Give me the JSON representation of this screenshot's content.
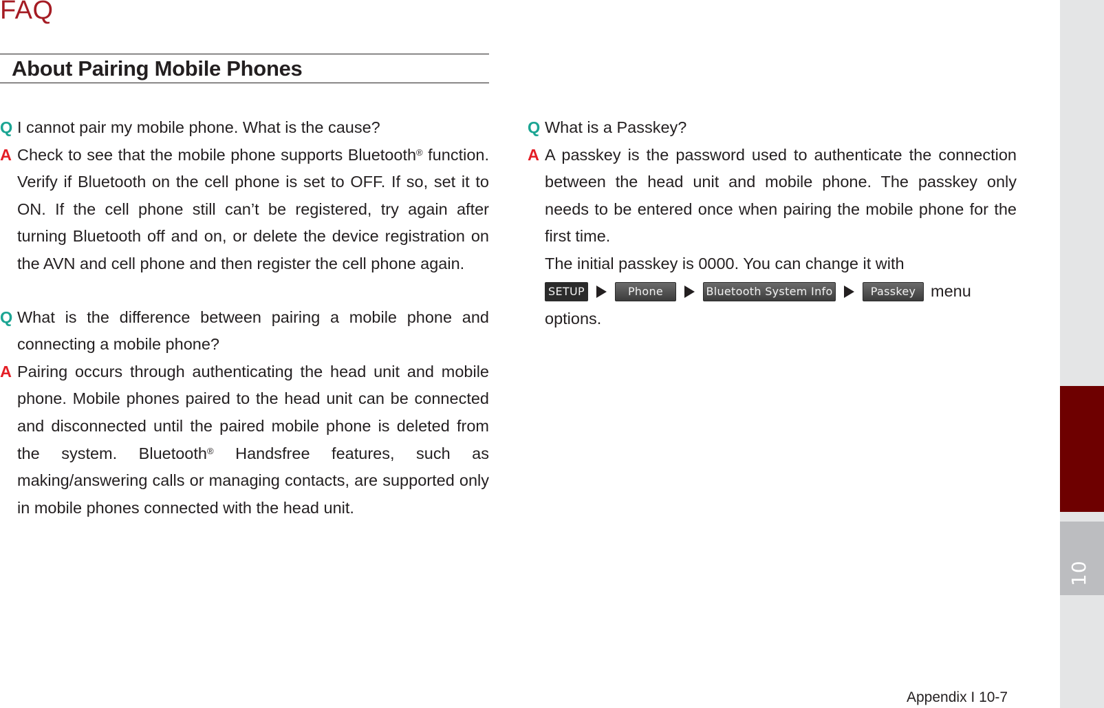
{
  "page_title": "FAQ",
  "section_heading": "About Pairing Mobile Phones",
  "left_column": [
    {
      "q_mark": "Q",
      "question": "I cannot pair my mobile phone. What is the cause?",
      "a_mark": "A",
      "answer_part1": "Check to see that the mobile phone supports Bluetooth",
      "answer_sup": "®",
      "answer_part2": " function. Verify if Bluetooth on the cell phone is set to OFF. If so, set it to ON. If the cell phone still can’t be registered, try again after turning Bluetooth off and on, or delete the device registration on the AVN and cell phone and then register the cell phone again."
    },
    {
      "q_mark": "Q",
      "question": "What is the difference between pairing a mobile phone and connecting a mobile phone?",
      "a_mark": "A",
      "answer_part1": "Pairing occurs through authenticating the head unit and mobile phone. Mobile phones paired to the head unit can be connected and disconnected until the paired mobile phone is deleted from the system. Bluetooth",
      "answer_sup": "®",
      "answer_part2": " Handsfree features, such as making/answering calls or managing contacts, are supported only in mobile phones connected with the head unit."
    }
  ],
  "right_column": {
    "q_mark": "Q",
    "question": "What is a Passkey?",
    "a_mark": "A",
    "answer": "A passkey is the password used to authenticate the connection between the head unit and mobile phone. The passkey only needs to be entered once when pairing the mobile phone for the first time.",
    "initial_text": "The initial passkey is 0000. You can change it with",
    "menu_path": [
      "SETUP",
      "Phone",
      "Bluetooth System Info",
      "Passkey"
    ],
    "menu_suffix": "menu",
    "menu_end": "options."
  },
  "footer": "Appendix I 10-7",
  "side_tab": {
    "chapter": "10"
  },
  "colors": {
    "faq_title": "#a51c24",
    "q_mark": "#1ba593",
    "a_mark": "#e41e26",
    "side_red": "#6e0000",
    "side_grey": "#bcbdc0",
    "side_strip": "#e4e5e6"
  }
}
